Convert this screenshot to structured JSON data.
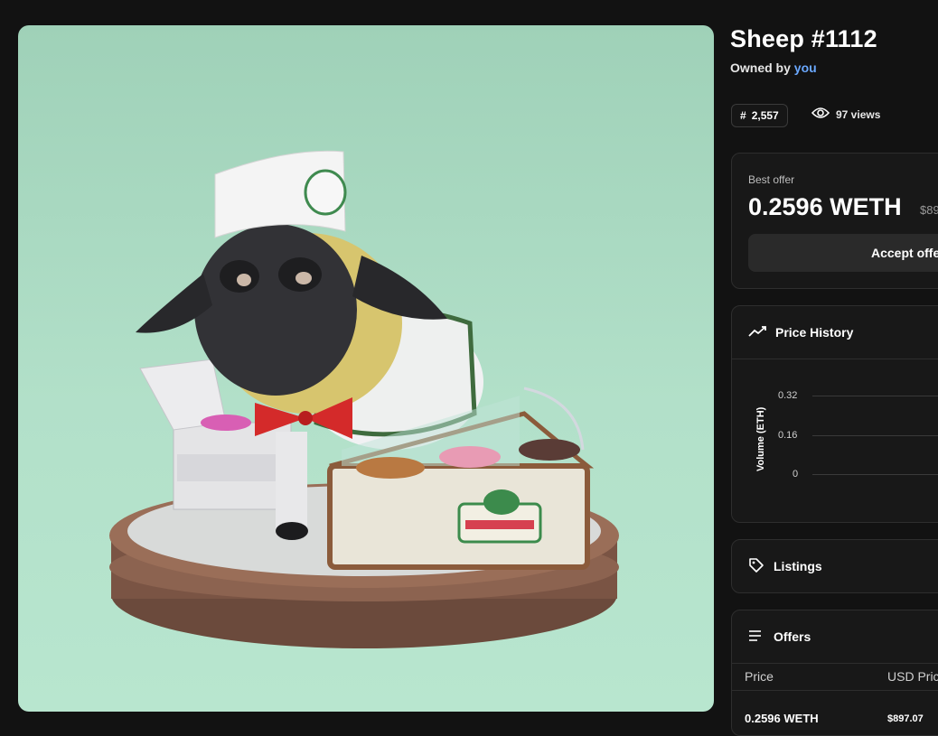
{
  "nft": {
    "title": "Sheep #1112",
    "owned_prefix": "Owned by",
    "owner": "you",
    "rank": "2,557",
    "rank_symbol": "#",
    "views": "97 views"
  },
  "best_offer": {
    "label": "Best offer",
    "price": "0.2596 WETH",
    "usd": "$89",
    "accept_label": "Accept offe"
  },
  "price_history": {
    "title": "Price History"
  },
  "chart_data": {
    "type": "line",
    "ylabel": "Volume (ETH)",
    "yticks": [
      "0.32",
      "0.16",
      "0"
    ],
    "ylim": [
      0,
      0.32
    ],
    "series": []
  },
  "listings": {
    "title": "Listings"
  },
  "offers": {
    "title": "Offers",
    "columns": [
      "Price",
      "USD Pric"
    ],
    "rows": [
      [
        "0.2596 WETH",
        "$897.07"
      ]
    ]
  },
  "icons": {
    "views": "eye-icon",
    "history": "trend-line-icon",
    "listings": "tag-icon",
    "offers": "list-icon"
  },
  "colors": {
    "background": "#121212",
    "owner_link": "#6aa8ff",
    "media_bg": "#b2e0c9"
  }
}
